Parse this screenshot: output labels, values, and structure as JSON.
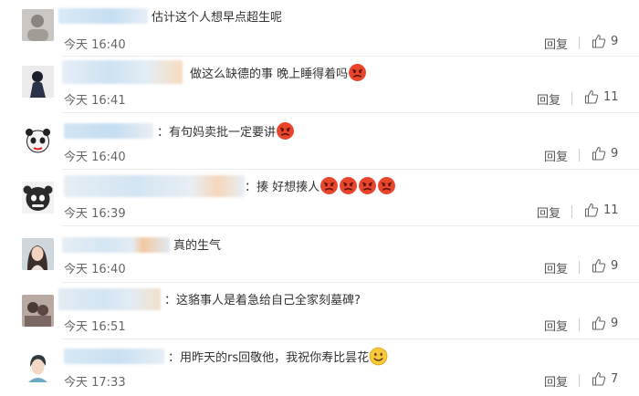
{
  "comments": [
    {
      "text": "估计这个人想早点超生呢",
      "time": "今天 16:40",
      "reply": "回复",
      "likes": "9"
    },
    {
      "text": "做这么缺德的事 晚上睡得着吗",
      "time": "今天 16:41",
      "reply": "回复",
      "likes": "11"
    },
    {
      "text": "：有句妈卖批一定要讲",
      "time": "今天 16:40",
      "reply": "回复",
      "likes": "9"
    },
    {
      "text": "：揍 好想揍人",
      "time": "今天 16:39",
      "reply": "回复",
      "likes": "11"
    },
    {
      "text": "真的生气",
      "time": "今天 16:40",
      "reply": "回复",
      "likes": "9"
    },
    {
      "text": "：这貉事人是着急给自己全家刻墓碑?",
      "time": "今天 16:51",
      "reply": "回复",
      "likes": "9"
    },
    {
      "text": "：用昨天的rs回敬他，我祝你寿比昙花",
      "time": "今天 17:33",
      "reply": "回复",
      "likes": "7"
    }
  ],
  "colors": {
    "angry_face": "#e8452c",
    "smile_face": "#f7c93a",
    "blur_blue": "#cfe4f5",
    "blur_orange": "#f5c59a"
  },
  "icons": {
    "like": "thumbs-up-icon",
    "angry": "angry-emoji-icon",
    "smile": "smile-emoji-icon"
  }
}
